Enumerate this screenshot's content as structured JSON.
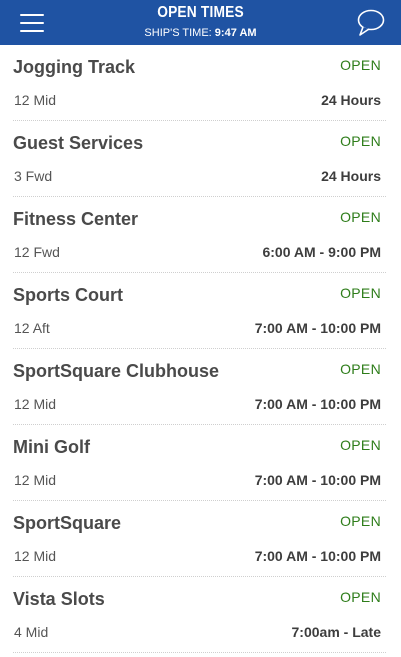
{
  "header": {
    "title": "OPEN TIMES",
    "ship_time_label": "SHIP'S TIME:",
    "ship_time_value": "9:47 AM",
    "menu_icon": "hamburger-menu-icon",
    "chat_icon": "chat-bubble-icon",
    "bar_color": "#1f53a3"
  },
  "colors": {
    "open_status": "#2e7d1a",
    "venue_name": "#4a4a4a"
  },
  "venues": [
    {
      "name": "Jogging Track",
      "status": "OPEN",
      "location": "12 Mid",
      "hours": "24 Hours"
    },
    {
      "name": "Guest Services",
      "status": "OPEN",
      "location": "3 Fwd",
      "hours": "24 Hours"
    },
    {
      "name": "Fitness Center",
      "status": "OPEN",
      "location": "12 Fwd",
      "hours": "6:00 AM - 9:00 PM"
    },
    {
      "name": "Sports Court",
      "status": "OPEN",
      "location": "12 Aft",
      "hours": "7:00 AM - 10:00 PM"
    },
    {
      "name": "SportSquare Clubhouse",
      "status": "OPEN",
      "location": "12 Mid",
      "hours": "7:00 AM - 10:00 PM"
    },
    {
      "name": "Mini Golf",
      "status": "OPEN",
      "location": "12 Mid",
      "hours": "7:00 AM - 10:00 PM"
    },
    {
      "name": "SportSquare",
      "status": "OPEN",
      "location": "12 Mid",
      "hours": "7:00 AM - 10:00 PM"
    },
    {
      "name": "Vista Slots",
      "status": "OPEN",
      "location": "4 Mid",
      "hours": "7:00am - Late"
    }
  ]
}
